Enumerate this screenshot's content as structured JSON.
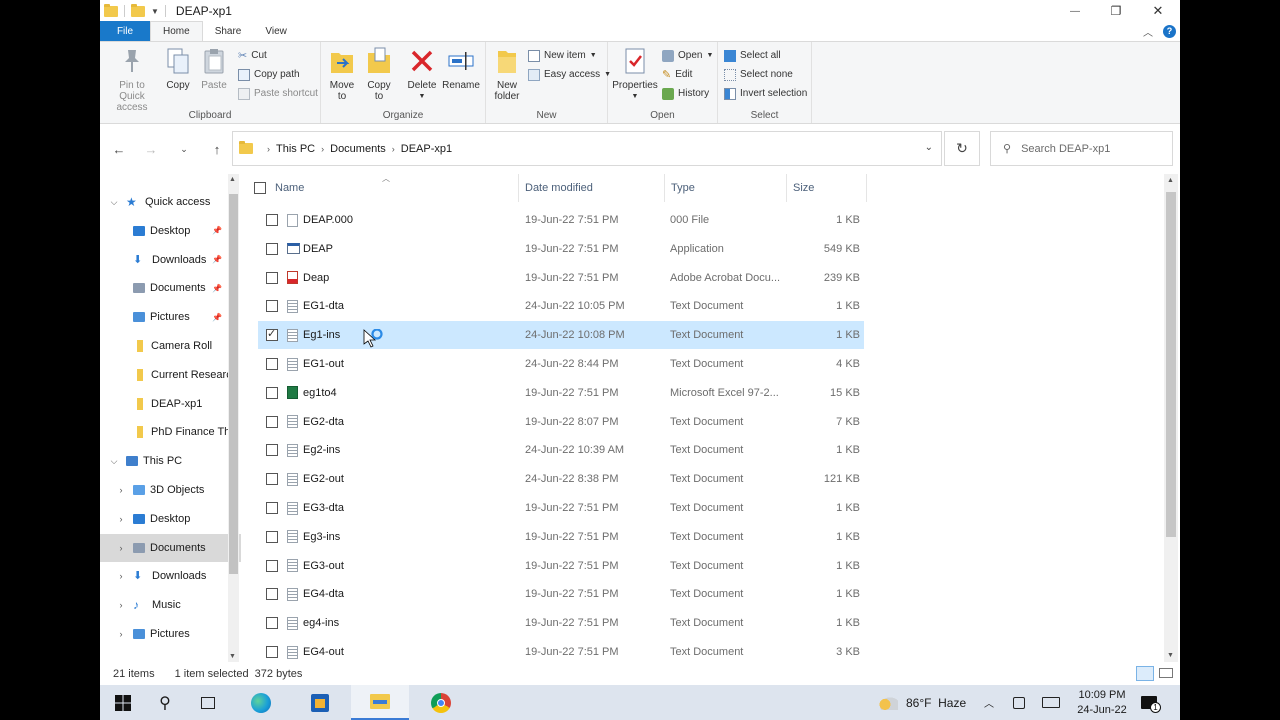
{
  "window": {
    "title": "DEAP-xp1",
    "minimize_glyph": "—",
    "restore_glyph": "❐",
    "close_glyph": "✕"
  },
  "tabs": [
    "File",
    "Home",
    "Share",
    "View"
  ],
  "ribbon": {
    "clipboard": {
      "label": "Clipboard",
      "pin": "Pin to Quick\naccess",
      "copy": "Copy",
      "paste": "Paste",
      "cut": "Cut",
      "copy_path": "Copy path",
      "paste_shortcut": "Paste shortcut"
    },
    "organize": {
      "label": "Organize",
      "move_to": "Move\nto",
      "copy_to": "Copy\nto",
      "delete": "Delete",
      "rename": "Rename"
    },
    "new": {
      "label": "New",
      "new_folder": "New\nfolder",
      "new_item": "New item",
      "easy_access": "Easy access"
    },
    "open": {
      "label": "Open",
      "properties": "Properties",
      "open": "Open",
      "edit": "Edit",
      "history": "History"
    },
    "select": {
      "label": "Select",
      "select_all": "Select all",
      "select_none": "Select none",
      "invert": "Invert selection"
    }
  },
  "address": {
    "crumbs": [
      "This PC",
      "Documents",
      "DEAP-xp1"
    ]
  },
  "search": {
    "placeholder": "Search DEAP-xp1"
  },
  "nav": {
    "items": [
      {
        "label": "Quick access",
        "kind": "quick",
        "chev": "v",
        "indent": 0
      },
      {
        "label": "Desktop",
        "kind": "desktop",
        "chev": "",
        "indent": 1,
        "pinned": true
      },
      {
        "label": "Downloads",
        "kind": "download",
        "chev": "",
        "indent": 1,
        "pinned": true
      },
      {
        "label": "Documents",
        "kind": "docs",
        "chev": "",
        "indent": 1,
        "pinned": true
      },
      {
        "label": "Pictures",
        "kind": "pictures",
        "chev": "",
        "indent": 1,
        "pinned": true
      },
      {
        "label": "Camera Roll",
        "kind": "folder",
        "chev": "",
        "indent": 1
      },
      {
        "label": "Current Research",
        "kind": "folder",
        "chev": "",
        "indent": 1
      },
      {
        "label": "DEAP-xp1",
        "kind": "folder",
        "chev": "",
        "indent": 1
      },
      {
        "label": "PhD Finance Th",
        "kind": "folder",
        "chev": "",
        "indent": 1
      },
      {
        "label": "This PC",
        "kind": "pc",
        "chev": "v",
        "indent": 0
      },
      {
        "label": "3D Objects",
        "kind": "3d",
        "chev": ">",
        "indent": 1
      },
      {
        "label": "Desktop",
        "kind": "desktop",
        "chev": ">",
        "indent": 1
      },
      {
        "label": "Documents",
        "kind": "docs",
        "chev": ">",
        "indent": 1,
        "selected": true
      },
      {
        "label": "Downloads",
        "kind": "download",
        "chev": ">",
        "indent": 1
      },
      {
        "label": "Music",
        "kind": "music",
        "chev": ">",
        "indent": 1
      },
      {
        "label": "Pictures",
        "kind": "pictures",
        "chev": ">",
        "indent": 1
      }
    ]
  },
  "columns": {
    "name": "Name",
    "date": "Date modified",
    "type": "Type",
    "size": "Size"
  },
  "files": [
    {
      "name": "DEAP.000",
      "date": "19-Jun-22 7:51 PM",
      "type": "000 File",
      "size": "1 KB",
      "icon": "blank"
    },
    {
      "name": "DEAP",
      "date": "19-Jun-22 7:51 PM",
      "type": "Application",
      "size": "549 KB",
      "icon": "app"
    },
    {
      "name": "Deap",
      "date": "19-Jun-22 7:51 PM",
      "type": "Adobe Acrobat Docu...",
      "size": "239 KB",
      "icon": "pdf"
    },
    {
      "name": "EG1-dta",
      "date": "24-Jun-22 10:05 PM",
      "type": "Text Document",
      "size": "1 KB",
      "icon": "txt"
    },
    {
      "name": "Eg1-ins",
      "date": "24-Jun-22 10:08 PM",
      "type": "Text Document",
      "size": "1 KB",
      "icon": "txt",
      "selected": true
    },
    {
      "name": "EG1-out",
      "date": "24-Jun-22 8:44 PM",
      "type": "Text Document",
      "size": "4 KB",
      "icon": "txt"
    },
    {
      "name": "eg1to4",
      "date": "19-Jun-22 7:51 PM",
      "type": "Microsoft Excel 97-2...",
      "size": "15 KB",
      "icon": "xls"
    },
    {
      "name": "EG2-dta",
      "date": "19-Jun-22 8:07 PM",
      "type": "Text Document",
      "size": "7 KB",
      "icon": "txt"
    },
    {
      "name": "Eg2-ins",
      "date": "24-Jun-22 10:39 AM",
      "type": "Text Document",
      "size": "1 KB",
      "icon": "txt"
    },
    {
      "name": "EG2-out",
      "date": "24-Jun-22 8:38 PM",
      "type": "Text Document",
      "size": "121 KB",
      "icon": "txt"
    },
    {
      "name": "EG3-dta",
      "date": "19-Jun-22 7:51 PM",
      "type": "Text Document",
      "size": "1 KB",
      "icon": "txt"
    },
    {
      "name": "Eg3-ins",
      "date": "19-Jun-22 7:51 PM",
      "type": "Text Document",
      "size": "1 KB",
      "icon": "txt"
    },
    {
      "name": "EG3-out",
      "date": "19-Jun-22 7:51 PM",
      "type": "Text Document",
      "size": "1 KB",
      "icon": "txt"
    },
    {
      "name": "EG4-dta",
      "date": "19-Jun-22 7:51 PM",
      "type": "Text Document",
      "size": "1 KB",
      "icon": "txt"
    },
    {
      "name": "eg4-ins",
      "date": "19-Jun-22 7:51 PM",
      "type": "Text Document",
      "size": "1 KB",
      "icon": "txt"
    },
    {
      "name": "EG4-out",
      "date": "19-Jun-22 7:51 PM",
      "type": "Text Document",
      "size": "3 KB",
      "icon": "txt"
    }
  ],
  "status": {
    "items": "21 items",
    "selection": "1 item selected  372 bytes"
  },
  "taskbar": {
    "weather": "86°F  Haze",
    "time": "10:09 PM",
    "date": "24-Jun-22",
    "notif_count": "1"
  },
  "colors": {
    "accent": "#1979ca",
    "selection": "#cce8ff",
    "folder": "#f2c94c"
  }
}
